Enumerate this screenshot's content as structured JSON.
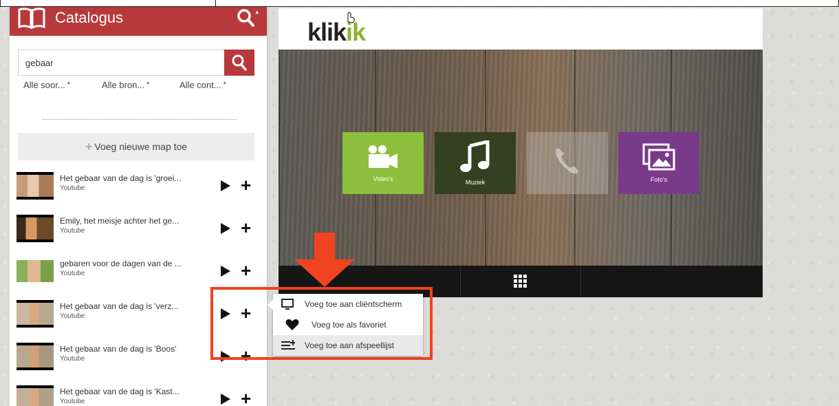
{
  "sidebar": {
    "title": "Catalogus",
    "search_value": "gebaar",
    "filters": [
      "Alle soor...",
      "Alle bron...",
      "Alle cont..."
    ],
    "add_folder_label": "Voeg nieuwe map toe",
    "items": [
      {
        "title": "Het gebaar van de dag is 'groei...",
        "source": "Youtube"
      },
      {
        "title": "Emily, het meisje achter het ge...",
        "source": "Youtube"
      },
      {
        "title": "gebaren voor de dagen van de ...",
        "source": "Youtube"
      },
      {
        "title": "Het gebaar van de dag is 'verz...",
        "source": "Youtube"
      },
      {
        "title": "Het gebaar van de dag is 'Boos'",
        "source": "Youtube"
      },
      {
        "title": "Het gebaar van de dag is 'Kast...",
        "source": "Youtube"
      }
    ]
  },
  "device": {
    "logo_part1": "klik",
    "logo_part2": "ik",
    "tiles": [
      {
        "label": "Video's",
        "icon": "video-camera-icon"
      },
      {
        "label": "Muziek",
        "icon": "music-note-icon"
      },
      {
        "label": "",
        "icon": "phone-icon"
      },
      {
        "label": "Foto's",
        "icon": "photos-icon"
      }
    ]
  },
  "popup": {
    "items": [
      {
        "label": "Voeg toe aan cliëntscherm",
        "icon": "monitor-icon"
      },
      {
        "label": "Voeg toe als favoriet",
        "icon": "heart-icon"
      },
      {
        "label": "Voeg toe aan afspeellijst",
        "icon": "playlist-add-icon"
      }
    ]
  },
  "colors": {
    "brand_red": "#b8393b",
    "accent_green": "#8dbf3c",
    "highlight_orange": "#f0431f"
  }
}
